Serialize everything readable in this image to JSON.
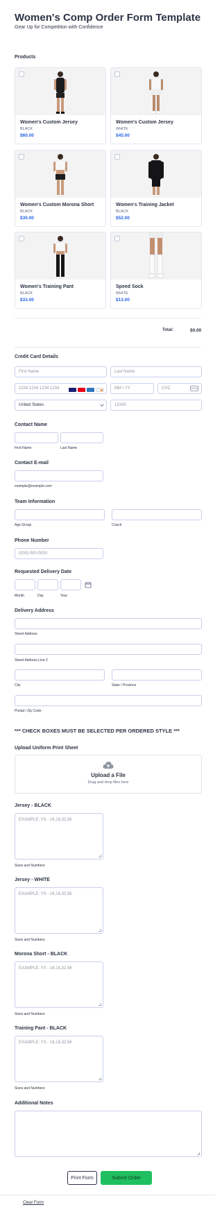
{
  "header": {
    "title": "Women's Comp Order Form Template",
    "subtitle": "Gear Up for Competition with Confidence"
  },
  "products": {
    "label": "Products",
    "items": [
      {
        "name": "Women's Custom Jersey",
        "color": "BLACK",
        "price": "$60.00"
      },
      {
        "name": "Women's Custom Jersey",
        "color": "WHITE",
        "price": "$45.00"
      },
      {
        "name": "Women's Custom Morona Short",
        "color": "BLACK",
        "price": "$30.00"
      },
      {
        "name": "Women's Training Jacket",
        "color": "BLACK",
        "price": "$52.00"
      },
      {
        "name": "Women's Training Pant",
        "color": "BLACK",
        "price": "$33.00"
      },
      {
        "name": "Speed Sock",
        "color": "WHITE",
        "price": "$13.00"
      }
    ],
    "total_label": "Total:",
    "total_value": "$0.00"
  },
  "credit_card": {
    "label": "Credit Card Details",
    "first_name_placeholder": "First Name",
    "last_name_placeholder": "Last Name",
    "card_number_placeholder": "1234 1234 1234 1234",
    "expiry_placeholder": "MM / YY",
    "cvc_placeholder": "CVC",
    "country_value": "United States",
    "postal_placeholder": "12345",
    "card_logos": [
      "VISA",
      "mastercard",
      "AMEX",
      "DISCOVER"
    ]
  },
  "contact_name": {
    "label": "Contact Name",
    "first_sub": "First Name",
    "last_sub": "Last Name"
  },
  "contact_email": {
    "label": "Contact E-mail",
    "sub": "example@example.com"
  },
  "team": {
    "label": "Team Information",
    "age_group_sub": "Age Group",
    "coach_sub": "Coach"
  },
  "phone": {
    "label": "Phone Number",
    "placeholder": "(000) 000-0000"
  },
  "delivery_date": {
    "label": "Requested Delivery Date",
    "month_sub": "Month",
    "day_sub": "Day",
    "year_sub": "Year"
  },
  "address": {
    "label": "Delivery Address",
    "street_sub": "Street Address",
    "street2_sub": "Street Address Line 2",
    "city_sub": "City",
    "state_sub": "State / Province",
    "postal_sub": "Postal / Zip Code"
  },
  "notice": "*** CHECK BOXES MUST BE SELECTED PER ORDERED STYLE ***",
  "upload": {
    "label": "Upload Uniform Print Sheet",
    "title": "Upload a File",
    "hint": "Drag and drop files here"
  },
  "sizes": [
    {
      "label": "Jersey - BLACK",
      "placeholder": "EXAMPLE: YS - 16,18,32,56",
      "sub": "Sizes and Numbers"
    },
    {
      "label": "Jersey - WHITE",
      "placeholder": "EXAMPLE: YS - 16,18,32,56",
      "sub": "Sizes and Numbers"
    },
    {
      "label": "Morona Short - BLACK",
      "placeholder": "EXAMPLE: YS - 16,18,32,56",
      "sub": "Sizes and Numbers"
    },
    {
      "label": "Training Pant - BLACK",
      "placeholder": "EXAMPLE: YS - 16,18,32,56",
      "sub": "Sizes and Numbers"
    }
  ],
  "notes": {
    "label": "Additional Notes"
  },
  "buttons": {
    "print": "Print Form",
    "submit": "Submit Order",
    "clear": "Clear Form"
  },
  "colors": {
    "accent_blue": "#2563eb",
    "submit_green": "#1fbf5f",
    "field_border": "#c8ceed"
  }
}
